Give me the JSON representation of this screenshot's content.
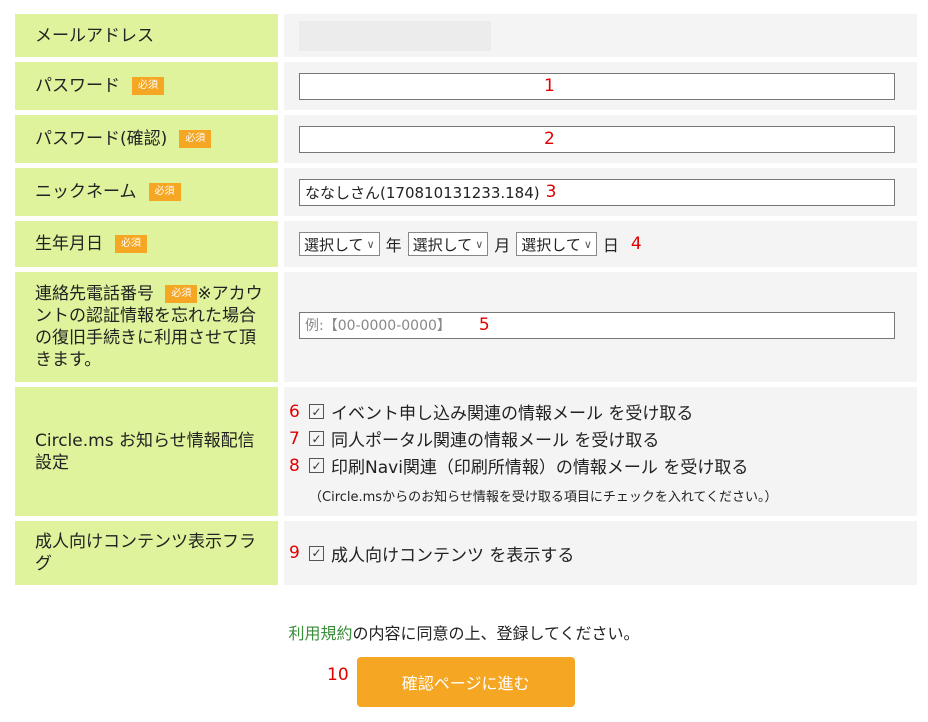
{
  "required_badge": "必須",
  "fields": {
    "email": {
      "label": "メールアドレス"
    },
    "password": {
      "label": "パスワード",
      "num": "1"
    },
    "password_confirm": {
      "label": "パスワード(確認)",
      "num": "2"
    },
    "nickname": {
      "label": "ニックネーム",
      "value": "ななしさん(170810131233.184)",
      "num": "3"
    },
    "birthdate": {
      "label": "生年月日",
      "select_text": "選択して",
      "year_unit": "年",
      "month_unit": "月",
      "day_unit": "日",
      "num": "4"
    },
    "phone": {
      "label": "連絡先電話番号",
      "note": "※アカウントの認証情報を忘れた場合の復旧手続きに利用させて頂きます。",
      "placeholder": "例:【00-0000-0000】",
      "num": "5"
    },
    "notifications": {
      "label": "Circle.ms お知らせ情報配信設定",
      "options": [
        {
          "num": "6",
          "text": "イベント申し込み関連の情報メール を受け取る"
        },
        {
          "num": "7",
          "text": "同人ポータル関連の情報メール を受け取る"
        },
        {
          "num": "8",
          "text": "印刷Navi関連（印刷所情報）の情報メール を受け取る"
        }
      ],
      "note": "（Circle.msからのお知らせ情報を受け取る項目にチェックを入れてください。）"
    },
    "adult": {
      "label": "成人向けコンテンツ表示フラグ",
      "num": "9",
      "text": "成人向けコンテンツ を表示する"
    }
  },
  "footer": {
    "link": "利用規約",
    "text": "の内容に同意の上、登録してください。",
    "num": "10",
    "submit": "確認ページに進む"
  },
  "colors": {
    "label_bg": "#def39b",
    "value_bg": "#f4f4f4",
    "badge": "#f5a623",
    "number": "#e00000"
  }
}
